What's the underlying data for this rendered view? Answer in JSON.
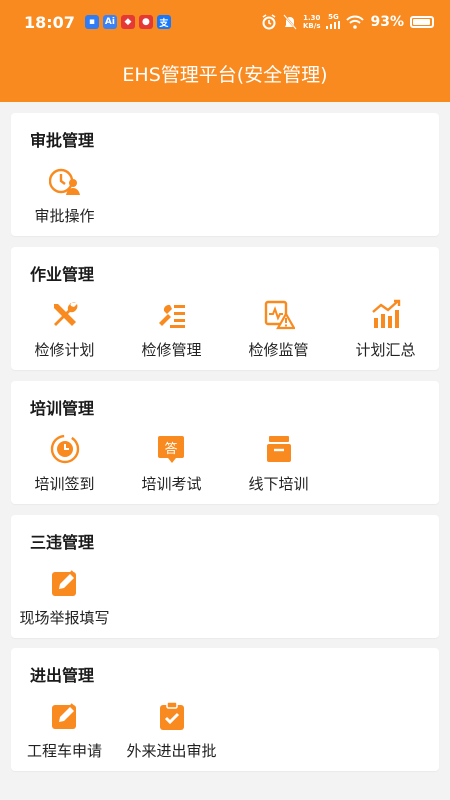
{
  "status_bar": {
    "time": "18:07",
    "network_speed": "1.30",
    "network_unit": "KB/s",
    "network_type": "5G",
    "battery": "93%"
  },
  "header": {
    "title": "EHS管理平台(安全管理)"
  },
  "colors": {
    "accent": "#f98a1f",
    "background": "#f3f3f3"
  },
  "sections": [
    {
      "title": "审批管理",
      "items": [
        {
          "label": "审批操作",
          "icon": "approval-clock-person-icon"
        }
      ]
    },
    {
      "title": "作业管理",
      "items": [
        {
          "label": "检修计划",
          "icon": "wrench-screwdriver-icon"
        },
        {
          "label": "检修管理",
          "icon": "tools-list-icon"
        },
        {
          "label": "检修监管",
          "icon": "monitor-warning-icon"
        },
        {
          "label": "计划汇总",
          "icon": "bar-chart-trend-icon"
        }
      ]
    },
    {
      "title": "培训管理",
      "items": [
        {
          "label": "培训签到",
          "icon": "clock-signin-icon"
        },
        {
          "label": "培训考试",
          "icon": "exam-answer-icon"
        },
        {
          "label": "线下培训",
          "icon": "inbox-box-icon"
        }
      ]
    },
    {
      "title": "三违管理",
      "items": [
        {
          "label": "现场举报填写",
          "icon": "edit-pencil-icon"
        }
      ]
    },
    {
      "title": "进出管理",
      "items": [
        {
          "label": "工程车申请",
          "icon": "edit-pencil-icon"
        },
        {
          "label": "外来进出审批",
          "icon": "clipboard-check-icon"
        }
      ]
    }
  ]
}
